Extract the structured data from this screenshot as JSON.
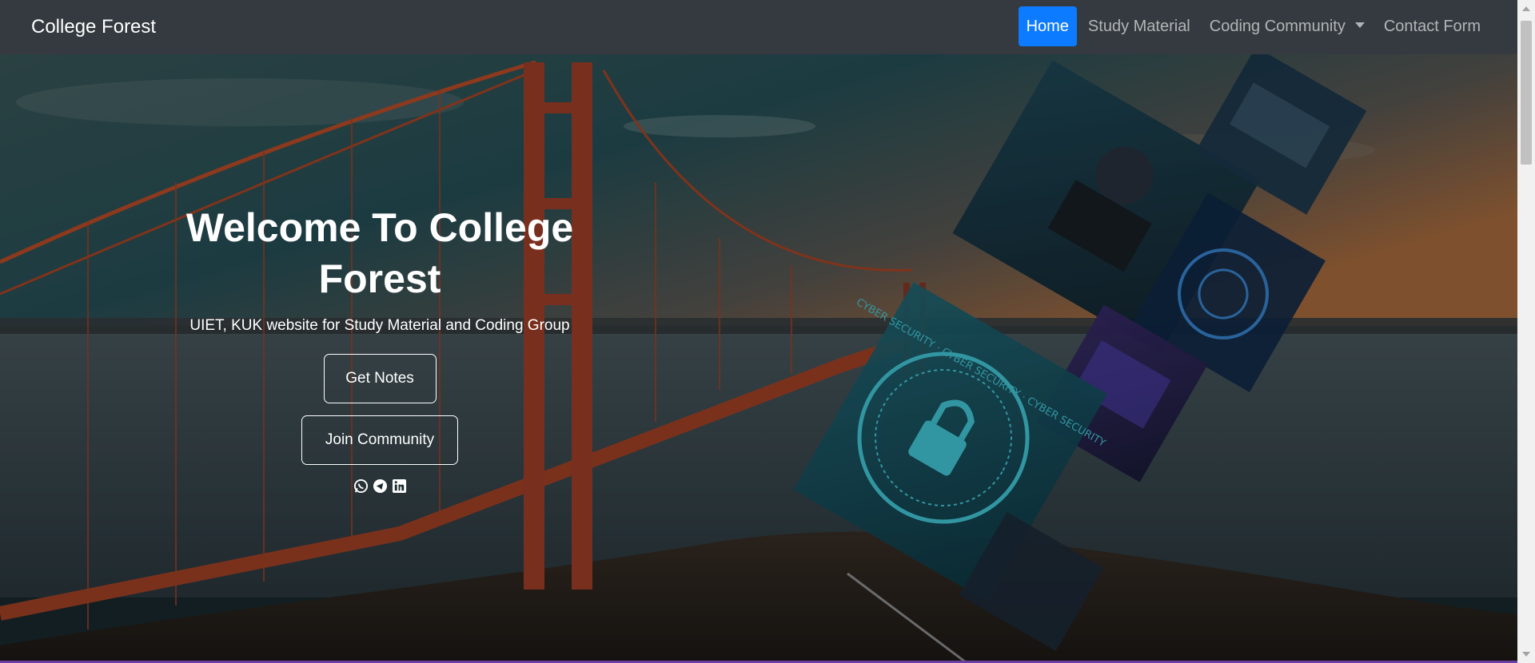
{
  "navbar": {
    "brand": "College Forest",
    "links": [
      {
        "label": "Home",
        "active": true
      },
      {
        "label": "Study Material",
        "active": false
      },
      {
        "label": "Coding Community",
        "active": false,
        "dropdown": true
      },
      {
        "label": "Contact Form",
        "active": false
      }
    ]
  },
  "hero": {
    "title": "Welcome To College Forest",
    "subtitle": "UIET, KUK website for Study Material and Coding Group",
    "buttons": {
      "notes": "Get Notes",
      "community": "Join Community"
    },
    "socials": [
      "whatsapp-icon",
      "telegram-icon",
      "linkedin-icon"
    ],
    "collage_text": "CYBER SECURITY · CYBER SECURITY · CYBER SECURITY"
  },
  "colors": {
    "navbar_bg": "#343a40",
    "active_link": "#0d7bff",
    "link_text": "rgba(255,255,255,0.62)"
  }
}
